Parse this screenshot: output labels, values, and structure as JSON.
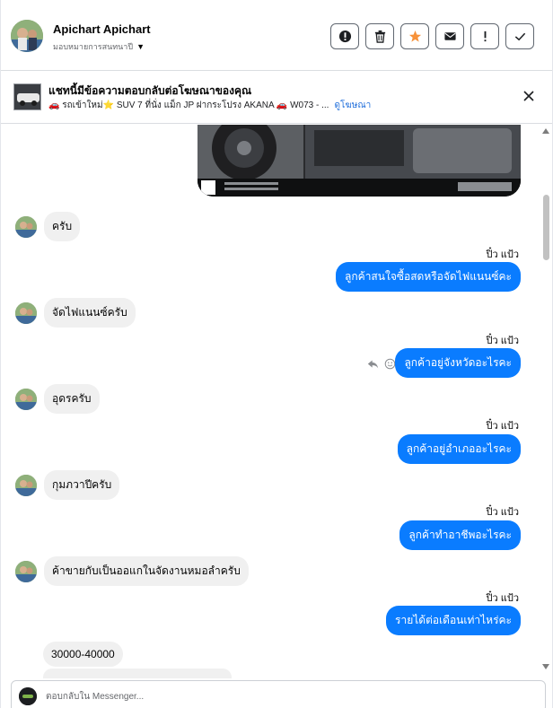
{
  "header": {
    "contact_name": "Apichart Apichart",
    "contact_sub": "มอบหมายการสนทนาปี",
    "actions": [
      {
        "name": "spam-button",
        "icon": "alert-circle-icon"
      },
      {
        "name": "delete-button",
        "icon": "trash-icon"
      },
      {
        "name": "star-button",
        "icon": "star-icon"
      },
      {
        "name": "mark-unread-button",
        "icon": "envelope-icon"
      },
      {
        "name": "follow-up-button",
        "icon": "exclamation-icon"
      },
      {
        "name": "done-button",
        "icon": "check-icon"
      }
    ],
    "star_color": "#f7923a"
  },
  "ad": {
    "title": "แชทนี้มีข้อความตอบกลับต่อโฆษณาของคุณ",
    "desc": "🚗 รถเข้าใหม่⭐ SUV 7 ที่นั่ง แม็ก JP ฝากระโปรง AKANA 🚗 W073 - ...",
    "link": "ดูโฆษณา"
  },
  "messages": {
    "in_1": "ครับ",
    "sender_1": "ปิ๋ว แป้ว",
    "out_1": "ลูกค้าสนใจซื้อสดหรือจัดไฟแนนซ์คะ",
    "in_2": "จัดไฟแนนซ์ครับ",
    "sender_2": "ปิ๋ว แป้ว",
    "out_2": "ลูกค้าอยู่จังหวัดอะไรคะ",
    "in_3": "อุดรครับ",
    "sender_3": "ปิ๋ว แป้ว",
    "out_3": "ลูกค้าอยู่อำเภออะไรคะ",
    "in_4": "กุมภวาปีครับ",
    "sender_4": "ปิ๋ว แป้ว",
    "out_4": "ลูกค้าทำอาชีพอะไรคะ",
    "in_5": "ค้าขายกับเป็นออแกในจัดงานหมอลำครับ",
    "sender_5": "ปิ๋ว แป้ว",
    "out_5": "รายได้ต่อเดือนเท่าไหร่คะ",
    "in_6": "30000-40000"
  },
  "composer": {
    "placeholder": "ตอบกลับใน Messenger..."
  },
  "colors": {
    "outgoing_bubble": "#0a7cff",
    "incoming_bubble": "#f0f0f0",
    "link": "#216fdb"
  }
}
